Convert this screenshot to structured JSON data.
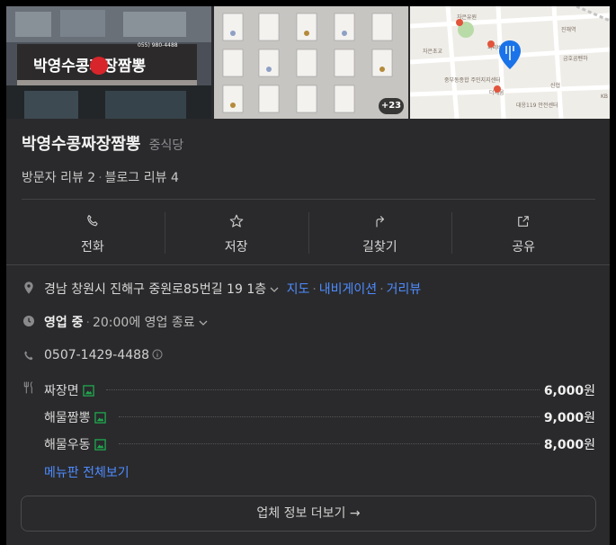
{
  "photos": {
    "storefront_sign": "박영수콩짜장짬뽕",
    "storefront_phone": "055) 980-4488",
    "more_count": "+23",
    "map_labels": [
      "자은유원",
      "진해역",
      "자은초교",
      "파리바게뜨",
      "금호곰펜하",
      "중부동종합 주민지지센터",
      "신협",
      "대응119 안전센터",
      "더체움",
      "KB"
    ]
  },
  "place": {
    "name": "박영수콩짜장짬뽕",
    "category": "중식당",
    "visitor_reviews": "방문자 리뷰 2",
    "blog_reviews": "블로그 리뷰 4"
  },
  "actions": [
    {
      "label": "전화",
      "icon": "phone-icon"
    },
    {
      "label": "저장",
      "icon": "star-icon"
    },
    {
      "label": "길찾기",
      "icon": "directions-icon"
    },
    {
      "label": "공유",
      "icon": "share-icon"
    }
  ],
  "info": {
    "address": "경남 창원시 진해구 중원로85번길 19 1층",
    "links": [
      "지도",
      "내비게이션",
      "거리뷰"
    ],
    "status": "영업 중",
    "hours": "20:00에 영업 종료",
    "phone": "0507-1429-4488"
  },
  "menu": {
    "items": [
      {
        "name": "짜장면",
        "price": "6,000",
        "unit": "원"
      },
      {
        "name": "해물짬뽕",
        "price": "9,000",
        "unit": "원"
      },
      {
        "name": "해물우동",
        "price": "8,000",
        "unit": "원"
      }
    ],
    "view_all": "메뉴판 전체보기"
  },
  "more_info_button": "업체 정보 더보기 →",
  "colors": {
    "background": "#2a2a2c",
    "link": "#4e8cff",
    "image_icon": "#1fa84f"
  }
}
